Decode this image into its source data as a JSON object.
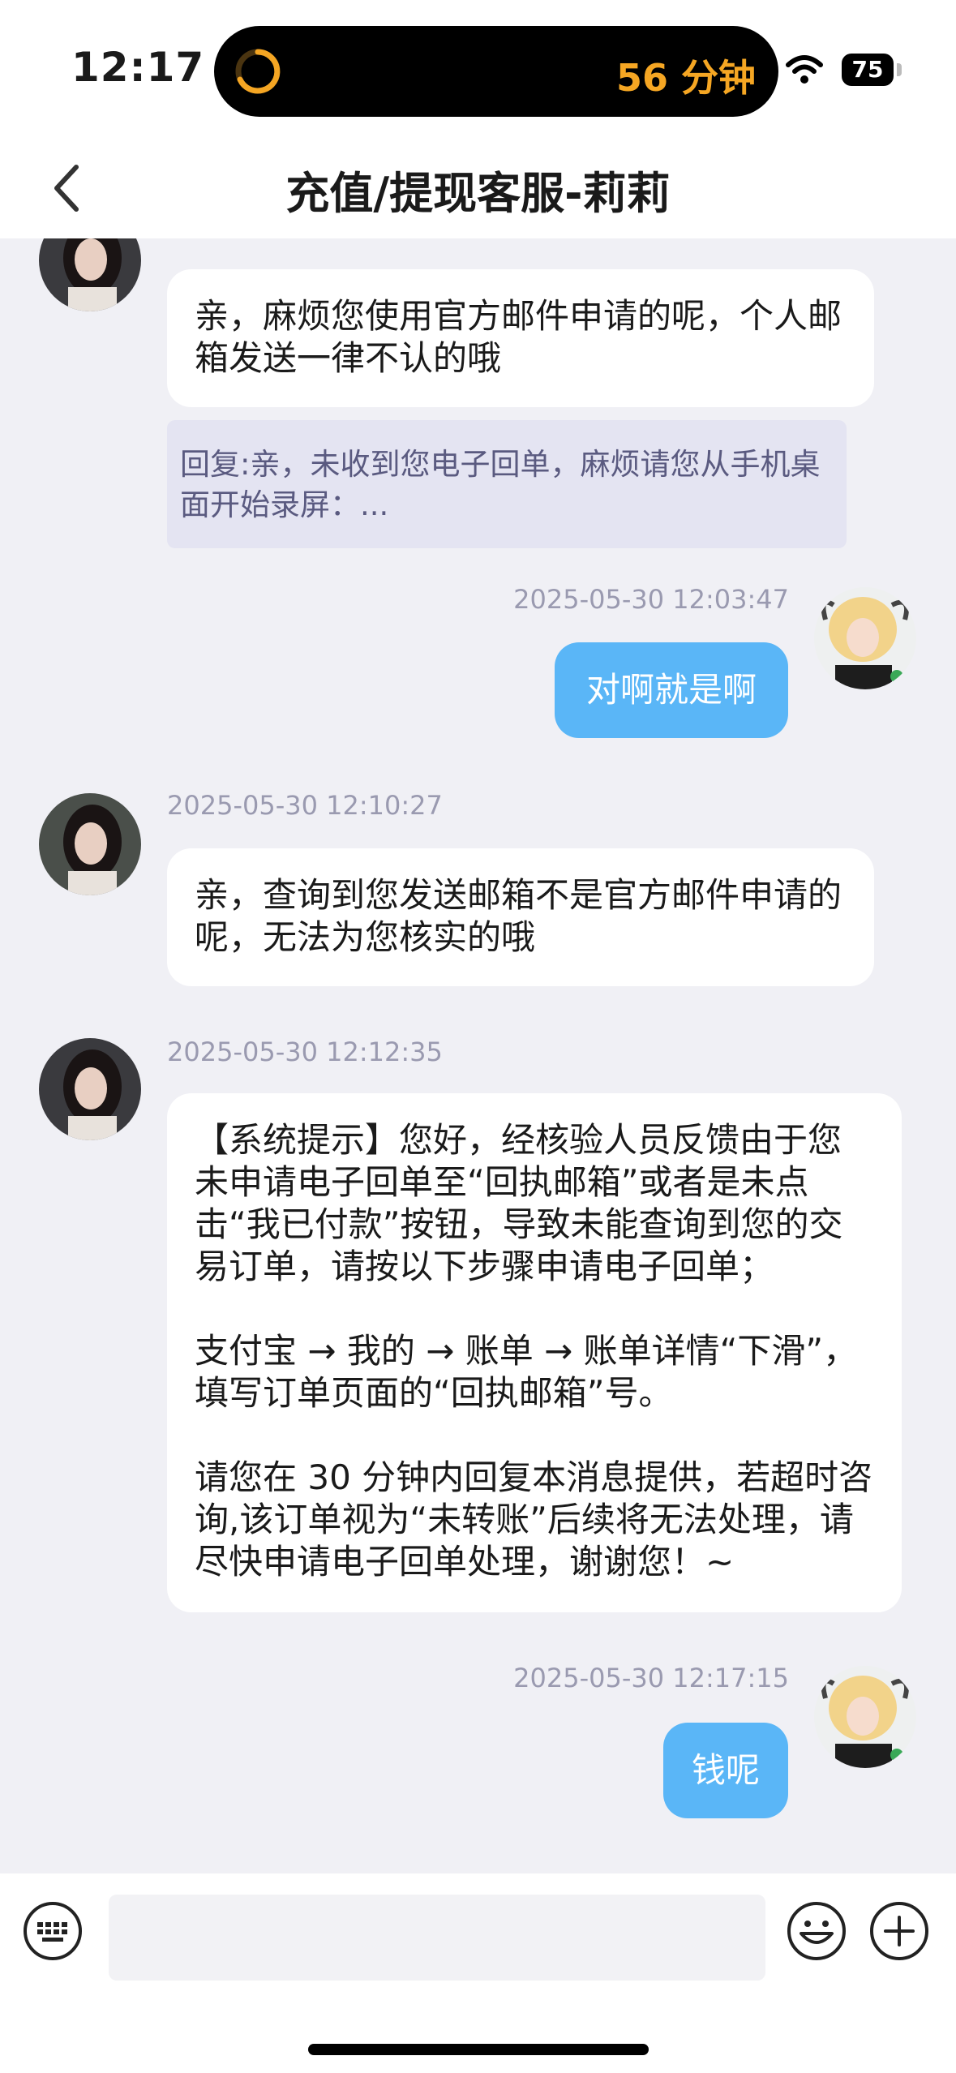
{
  "status_bar": {
    "time": "12:17",
    "timer_text": "56 分钟",
    "battery": "75",
    "icons": [
      "timer-ring-icon",
      "wifi-icon",
      "battery-icon"
    ]
  },
  "header": {
    "title": "充值/提现客服-莉莉",
    "back_icon": "chevron-left-icon"
  },
  "messages": [
    {
      "side": "agent",
      "text": "亲，麻烦您使用官方邮件申请的呢，个人邮箱发送一律不认的哦",
      "quote_label": "回复:",
      "quote_text": "亲，未收到您电子回单，麻烦请您从手机桌面开始录屏：..."
    },
    {
      "side": "user",
      "timestamp": "2025-05-30 12:03:47",
      "text": "对啊就是啊"
    },
    {
      "side": "agent",
      "timestamp": "2025-05-30 12:10:27",
      "text": "亲，查询到您发送邮箱不是官方邮件申请的呢，无法为您核实的哦"
    },
    {
      "side": "agent",
      "timestamp": "2025-05-30 12:12:35",
      "text": "【系统提示】您好，经核验人员反馈由于您未申请电子回单至“回执邮箱”或者是未点击“我已付款”按钮，导致未能查询到您的交易订单，请按以下步骤申请电子回单；\n\n支付宝 → 我的 → 账单 → 账单详情“下滑”，填写订单页面的“回执邮箱”号。\n\n请您在 30 分钟内回复本消息提供，若超时咨询,该订单视为“未转账”后续将无法处理，请尽快申请电子回单处理，谢谢您！~"
    },
    {
      "side": "user",
      "timestamp": "2025-05-30 12:17:15",
      "text": "钱呢"
    }
  ],
  "input_bar": {
    "placeholder": "",
    "icons": [
      "keyboard-icon",
      "emoji-icon",
      "plus-icon"
    ]
  },
  "colors": {
    "user_bubble": "#5ab6f7",
    "agent_bubble": "#ffffff",
    "background": "#f0f0f5",
    "timer": "#f5a623"
  }
}
